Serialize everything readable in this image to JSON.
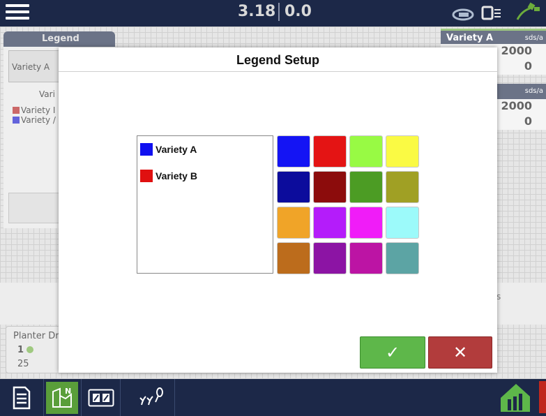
{
  "topbar": {
    "readout_left": "3.18",
    "readout_right": "0.0"
  },
  "background": {
    "legend_tab": "Legend",
    "variety_selector": "Variety A",
    "variety_heading": "Vari",
    "variety_items": [
      {
        "label": "Variety I",
        "color": "#b01818"
      },
      {
        "label": "Variety /",
        "color": "#1010c8"
      }
    ],
    "right_cards": [
      {
        "title": "Variety A",
        "unit": "sds/a",
        "value1": "2000",
        "value2": "0"
      },
      {
        "title": "",
        "unit": "sds/a",
        "value1": "2000",
        "value2": "0"
      }
    ],
    "side_s": "s",
    "planter": {
      "title": "Planter Dr",
      "row": "1",
      "value": "25"
    }
  },
  "dialog": {
    "title": "Legend Setup",
    "legend_items": [
      {
        "label": "Variety A",
        "color": "#1010f0"
      },
      {
        "label": "Variety B",
        "color": "#e01010"
      }
    ],
    "palette": [
      "#1414f4",
      "#e41414",
      "#98fa44",
      "#fafa44",
      "#0c0c9c",
      "#8c0c0c",
      "#4c9c24",
      "#a0a024",
      "#f0a428",
      "#b41cfa",
      "#f01cf8",
      "#9cfafa",
      "#bc6c1c",
      "#8c14a4",
      "#bc14a4",
      "#5ca4a4"
    ],
    "ok_icon": "check-icon",
    "ok_symbol": "✓",
    "cancel_icon": "close-icon",
    "cancel_symbol": "✕"
  },
  "bottombar": {
    "buttons": [
      "report-icon",
      "field-map-icon",
      "split-view-icon",
      "plant-icon"
    ],
    "active": "field-map-icon",
    "home_icon": "home-icon"
  }
}
